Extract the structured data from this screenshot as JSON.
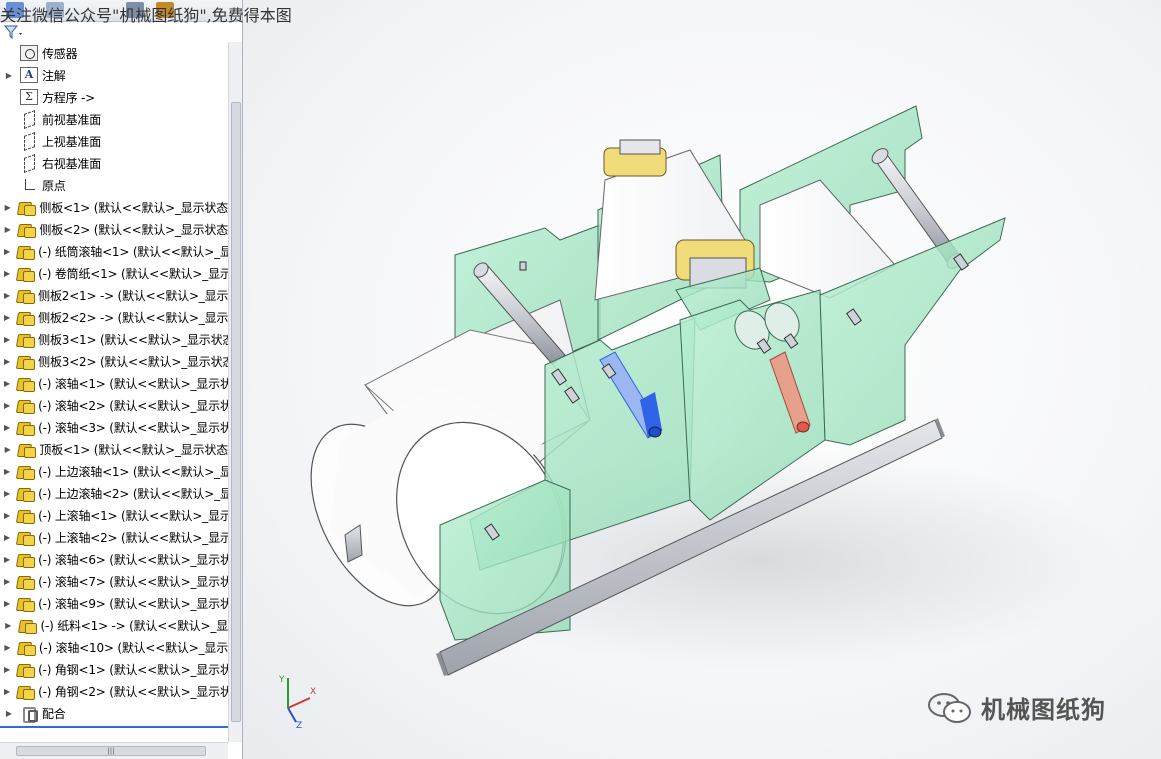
{
  "watermark_top": "关注微信公众号\"机械图纸狗\",免费得本图",
  "brand_mark": "机械图纸狗",
  "feature_tree": {
    "items": [
      {
        "label": "传感器",
        "icon": "sensor-icon",
        "expandable": false
      },
      {
        "label": "注解",
        "icon": "annotation-icon",
        "expandable": true
      },
      {
        "label": "方程序 ->",
        "icon": "equation-icon",
        "expandable": false
      },
      {
        "label": "前视基准面",
        "icon": "plane-icon",
        "expandable": false
      },
      {
        "label": "上视基准面",
        "icon": "plane-icon",
        "expandable": false
      },
      {
        "label": "右视基准面",
        "icon": "plane-icon",
        "expandable": false
      },
      {
        "label": "原点",
        "icon": "origin-icon",
        "expandable": false
      },
      {
        "label": "侧板<1> (默认<<默认>_显示状态",
        "icon": "part-icon",
        "expandable": true
      },
      {
        "label": "侧板<2> (默认<<默认>_显示状态",
        "icon": "part-icon",
        "expandable": true
      },
      {
        "label": "(-) 纸筒滚轴<1> (默认<<默认>_显",
        "icon": "part-icon",
        "expandable": true
      },
      {
        "label": "(-) 卷筒纸<1> (默认<<默认>_显示",
        "icon": "part-icon",
        "expandable": true
      },
      {
        "label": "侧板2<1> -> (默认<<默认>_显示",
        "icon": "part-icon",
        "expandable": true
      },
      {
        "label": "侧板2<2> -> (默认<<默认>_显示",
        "icon": "part-icon",
        "expandable": true
      },
      {
        "label": "侧板3<1> (默认<<默认>_显示状态",
        "icon": "part-icon",
        "expandable": true
      },
      {
        "label": "侧板3<2> (默认<<默认>_显示状态",
        "icon": "part-icon",
        "expandable": true
      },
      {
        "label": "(-) 滚轴<1> (默认<<默认>_显示状",
        "icon": "part-icon",
        "expandable": true
      },
      {
        "label": "(-) 滚轴<2> (默认<<默认>_显示状",
        "icon": "part-icon",
        "expandable": true
      },
      {
        "label": "(-) 滚轴<3> (默认<<默认>_显示状",
        "icon": "part-icon",
        "expandable": true
      },
      {
        "label": "顶板<1> (默认<<默认>_显示状态",
        "icon": "part-icon",
        "expandable": true
      },
      {
        "label": "(-) 上边滚轴<1> (默认<<默认>_显",
        "icon": "part-icon",
        "expandable": true
      },
      {
        "label": "(-) 上边滚轴<2> (默认<<默认>_显",
        "icon": "part-icon",
        "expandable": true
      },
      {
        "label": "(-) 上滚轴<1> (默认<<默认>_显示",
        "icon": "part-icon",
        "expandable": true
      },
      {
        "label": "(-) 上滚轴<2> (默认<<默认>_显示",
        "icon": "part-icon",
        "expandable": true
      },
      {
        "label": "(-) 滚轴<6> (默认<<默认>_显示状",
        "icon": "part-icon",
        "expandable": true
      },
      {
        "label": "(-) 滚轴<7> (默认<<默认>_显示状",
        "icon": "part-icon",
        "expandable": true
      },
      {
        "label": "(-) 滚轴<9> (默认<<默认>_显示状",
        "icon": "part-icon",
        "expandable": true
      },
      {
        "label": "(-) 纸料<1> -> (默认<<默认>_显",
        "icon": "part-icon",
        "expandable": true
      },
      {
        "label": "(-) 滚轴<10> (默认<<默认>_显示",
        "icon": "part-icon",
        "expandable": true
      },
      {
        "label": "(-) 角钢<1> (默认<<默认>_显示状",
        "icon": "part-icon",
        "expandable": true
      },
      {
        "label": "(-) 角钢<2> (默认<<默认>_显示状",
        "icon": "part-icon",
        "expandable": true
      },
      {
        "label": "配合",
        "icon": "mate-icon",
        "expandable": true
      }
    ]
  },
  "scrollbar": {
    "thumb_grip": "|||"
  },
  "triad": {
    "x": "X",
    "y": "Y",
    "z": "Z"
  },
  "colors": {
    "glass_panel": "#9fe3c0",
    "paper": "#ffffff",
    "roller_blue": "#2f63e8",
    "roller_red": "#e05a4a",
    "steel": "#b8bcc4",
    "bearing_yellow": "#f1dc7a"
  }
}
